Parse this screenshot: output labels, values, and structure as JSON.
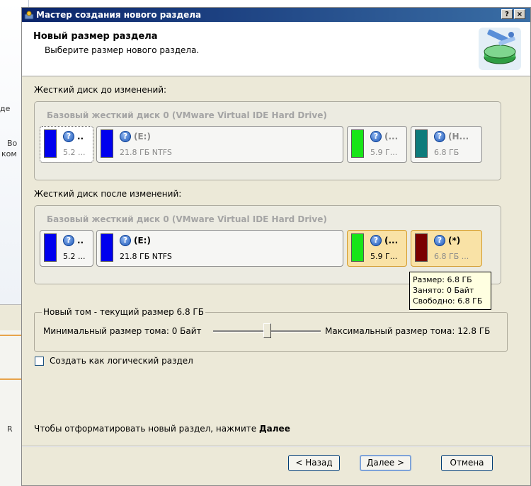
{
  "background": {
    "texts": [
      "де",
      "Во",
      "ком",
      "R"
    ]
  },
  "window": {
    "title": "Мастер создания нового раздела",
    "help_button": "?",
    "close_button": "×"
  },
  "header": {
    "title": "Новый размер раздела",
    "subtitle": "Выберите размер нового раздела."
  },
  "before": {
    "label": "Жесткий диск до изменений:",
    "disk_name": "Базовый жесткий диск 0 (VMware Virtual IDE Hard Drive)",
    "partitions": [
      {
        "name": "..",
        "size": "5.2 ...",
        "color": "#0000ee"
      },
      {
        "name": "(E:)",
        "size": "21.8 ГБ NTFS",
        "color": "#0000ee"
      },
      {
        "name": "(...",
        "size": "5.9 Г...",
        "color": "#18e518"
      },
      {
        "name": "(Н...",
        "size": "6.8 ГБ",
        "color": "#0e7b7b"
      }
    ]
  },
  "after": {
    "label": "Жесткий диск после изменений:",
    "disk_name": "Базовый жесткий диск 0 (VMware Virtual IDE Hard Drive)",
    "partitions": [
      {
        "name": "..",
        "size": "5.2 ...",
        "color": "#0000ee"
      },
      {
        "name": "(E:)",
        "size": "21.8 ГБ NTFS",
        "color": "#0000ee"
      },
      {
        "name": "(...",
        "size": "5.9 Г...",
        "color": "#18e518"
      },
      {
        "name": "(*)",
        "size": "6.8 ГБ ...",
        "color": "#7a0000"
      }
    ]
  },
  "tooltip": {
    "size": "Размер: 6.8 ГБ",
    "used": "Занято: 0 Байт",
    "free": "Свободно: 6.8 ГБ"
  },
  "volume": {
    "legend": "Новый том - текущий размер 6.8 ГБ",
    "min_label": "Минимальный размер тома:",
    "min_value": "0 Байт",
    "max_label": "Максимальный размер тома:",
    "max_value": "12.8 ГБ",
    "slider_fraction": 0.53
  },
  "logical": {
    "label": "Создать как логический раздел",
    "checked": false
  },
  "hint": {
    "text": "Чтобы отформатировать новый раздел, нажмите ",
    "bold": "Далее"
  },
  "buttons": {
    "back": "< Назад",
    "next": "Далее >",
    "cancel": "Отмена"
  },
  "icons": {
    "app": "wizard-app-icon",
    "header": "disk-wizard-icon",
    "info": "question-icon"
  }
}
